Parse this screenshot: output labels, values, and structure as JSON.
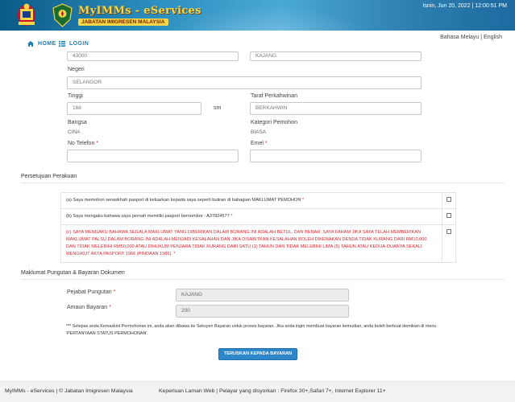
{
  "header": {
    "brand_title": "MyIMMs - eServices",
    "brand_subtitle": "JABATAN IMIGRESEN MALAYSIA",
    "datetime": "Isnin, Jun 20, 2022 | 12:00:51 PM",
    "colors": {
      "banner": "#2c8fbf",
      "brand": "#f4d646"
    }
  },
  "nav": {
    "home_label": "HOME",
    "login_label": "LOGIN",
    "language": "Bahasa Melayu | English",
    "home_icon": "home-icon",
    "login_icon": "list-icon"
  },
  "form": {
    "partial_left_value": "43000",
    "partial_right_value": "KAJANG",
    "negeri_label": "Negeri",
    "negeri_value": "SELANGOR",
    "tinggi_label": "Tinggi",
    "tinggi_value": "168",
    "tinggi_unit": "sm",
    "taraf_label": "Taraf Perkahwinan",
    "taraf_value": "BERKAHWIN",
    "bangsa_label": "Bangsa",
    "bangsa_value": "CINA",
    "kategori_label": "Kategori Pemohon",
    "kategori_value": "BIASA",
    "telefon_label": "No Telefon",
    "telefon_value": "",
    "emel_label": "Emel",
    "emel_value": "",
    "required_mark": "*"
  },
  "consent": {
    "title": "Persetujuan Perakuan",
    "items": [
      {
        "text": "(a) Saya memohon senaskhah pasport di keluarkan kepada saya seperti butiran di bahagian MAKLUMAT PEMOHON",
        "checked": false
      },
      {
        "text": "(b) Saya mengaku bahawa saya pernah memiliki pasport bernombor : A37824577",
        "checked": false
      },
      {
        "text": "(c) SAYA MENGAKU BAHAWA SEGALA MAKLUMAT YANG DIBERIKAN DALAM BORANG INI ADALAH BETUL, DAN BENAR. SAYA FAHAM JIKA SAYA TELAH MEMBERIKAN MAKLUMAT PALSU DALAM BORANG INI ADALAH MENJADI KESALAHAN DAN JIKA DISABITKAN KESALAHAN BOLEH DIKENAKAN DENDA TIDAK KURANG DARI RM10,000 DAN TIDAK MELEBIHI RM50,000 ATAU DIHUKUM PENJARA TIDAK KURANG DARI SATU (1) TAHUN DAN TIDAK MELEBIHI LIMA (5) TAHUN ATAU KEDUA-DUANYA SEKALI MENGIKUT AKTA PASPORT 1966 (PINDAAN 1986).",
        "checked": false
      }
    ]
  },
  "payment": {
    "title": "Maklumat Pungutan & Bayaran Dokumen",
    "pejabat_label": "Pejabat Pungutan",
    "pejabat_value": "KAJANG",
    "amaun_label": "Amaun Bayaran",
    "amaun_value": "200",
    "note": "*** Selepas anda Kemaskini Permohonan ini, anda akan dibawa ke Seksyen Bayaran untuk proses bayaran. Jika anda ingin membuat bayaran kemudian, anda boleh berbuat demikian di menu 'PERTANYAAN STATUS PERMOHONAN'.",
    "button_label": "TERUSKAN KEPADA BAYARAN",
    "button_color": "#2f86c8"
  },
  "footer": {
    "left": "MyIMMs - eServices | © Jabatan Imigresen Malaysia",
    "right": "Keperluan Laman Web | Pelayar yang disyorkan : Firefox 30+,Safari 7+, Internet Explorer 11+"
  }
}
